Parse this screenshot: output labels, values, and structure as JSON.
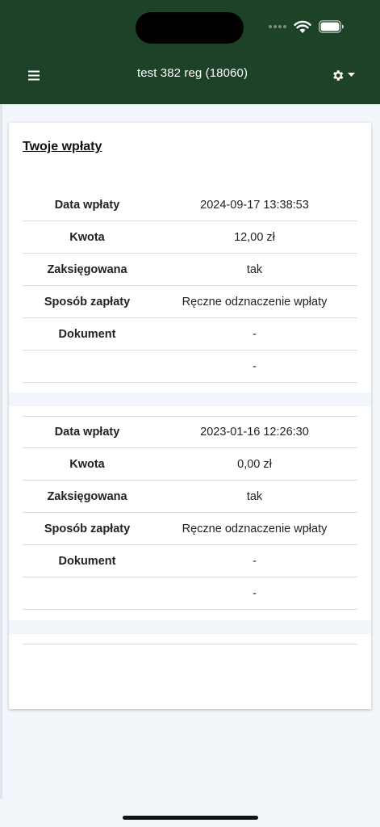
{
  "header": {
    "title": "test 382 reg (18060)",
    "background": "#1e4228"
  },
  "card": {
    "title": "Twoje wpłaty"
  },
  "payments": [
    {
      "rows": [
        {
          "label": "Data wpłaty",
          "value": "2024-09-17 13:38:53"
        },
        {
          "label": "Kwota",
          "value": "12,00 zł"
        },
        {
          "label": "Zaksięgowana",
          "value": "tak"
        },
        {
          "label": "Sposób zapłaty",
          "value": "Ręczne odznaczenie wpłaty"
        },
        {
          "label": "Dokument",
          "value": "-"
        },
        {
          "label": "",
          "value": "-"
        }
      ]
    },
    {
      "rows": [
        {
          "label": "Data wpłaty",
          "value": "2023-01-16 12:26:30"
        },
        {
          "label": "Kwota",
          "value": "0,00 zł"
        },
        {
          "label": "Zaksięgowana",
          "value": "tak"
        },
        {
          "label": "Sposób zapłaty",
          "value": "Ręczne odznaczenie wpłaty"
        },
        {
          "label": "Dokument",
          "value": "-"
        },
        {
          "label": "",
          "value": "-"
        }
      ]
    }
  ],
  "icons": {
    "menu": "hamburger-menu-icon",
    "settings": "gear-icon",
    "dropdown": "caret-down-icon",
    "wifi": "wifi-icon",
    "battery": "battery-icon"
  }
}
